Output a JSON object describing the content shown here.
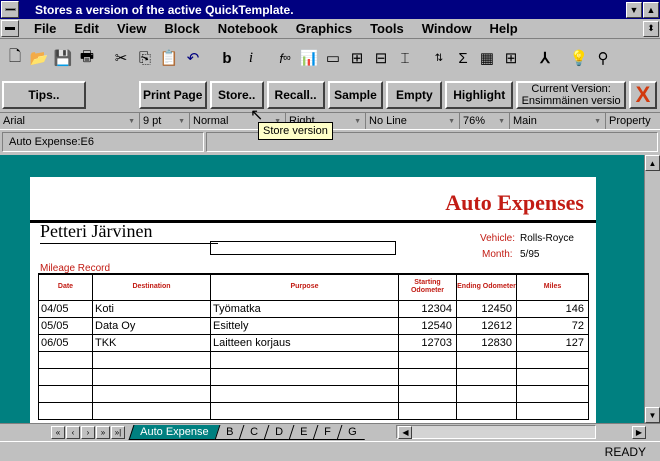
{
  "window": {
    "title": "Stores a version of the active QuickTemplate."
  },
  "menu": [
    "File",
    "Edit",
    "View",
    "Block",
    "Notebook",
    "Graphics",
    "Tools",
    "Window",
    "Help"
  ],
  "toolbar_icons": [
    "new-icon",
    "open-icon",
    "save-icon",
    "print-icon",
    "cut-icon",
    "copy-icon",
    "paste-icon",
    "undo-icon",
    "bold-icon",
    "italic-icon",
    "formula-icon",
    "chart-icon",
    "border-icon",
    "align-icon",
    "sort-icon",
    "sum-icon",
    "table-icon",
    "style-icon",
    "help-icon"
  ],
  "speedbar": {
    "tips": "Tips..",
    "print_page": "Print Page",
    "store": "Store..",
    "recall": "Recall..",
    "sample": "Sample",
    "empty": "Empty",
    "highlight": "Highlight",
    "version_line1": "Current Version:",
    "version_line2": "Ensimmäinen versio",
    "close": "X"
  },
  "property_band": {
    "font": "Arial",
    "size": "9 pt",
    "style": "Normal",
    "align": "Right",
    "line": "No Line",
    "zoom": "76%",
    "page": "Main",
    "property": "Property"
  },
  "tooltip": "Store version",
  "input_line": {
    "cell": "Auto Expense:E6",
    "content": ""
  },
  "sheet": {
    "title": "Auto Expenses",
    "owner": "Petteri Järvinen",
    "vehicle_label": "Vehicle:",
    "vehicle": "Rolls-Royce",
    "month_label": "Month:",
    "month": "5/95",
    "mileage_label": "Mileage Record",
    "columns": [
      "Date",
      "Destination",
      "Purpose",
      "Starting Odometer",
      "Ending Odometer",
      "Miles"
    ],
    "rows": [
      [
        "04/05",
        "Koti",
        "Työmatka",
        "12304",
        "12450",
        "146"
      ],
      [
        "05/05",
        "Data Oy",
        "Esittely",
        "12540",
        "12612",
        "72"
      ],
      [
        "06/05",
        "TKK",
        "Laitteen korjaus",
        "12703",
        "12830",
        "127"
      ],
      [
        "",
        "",
        "",
        "",
        "",
        ""
      ],
      [
        "",
        "",
        "",
        "",
        "",
        ""
      ],
      [
        "",
        "",
        "",
        "",
        "",
        ""
      ],
      [
        "",
        "",
        "",
        "",
        "",
        ""
      ]
    ]
  },
  "tabs": [
    "Auto Expense",
    "B",
    "C",
    "D",
    "E",
    "F",
    "G"
  ],
  "nav_buttons": [
    "«",
    "‹",
    "›",
    "»",
    "»|"
  ],
  "status": "READY",
  "colors": {
    "accent_red": "#c21c14",
    "titlebar": "#000080",
    "workspace": "#008080"
  }
}
